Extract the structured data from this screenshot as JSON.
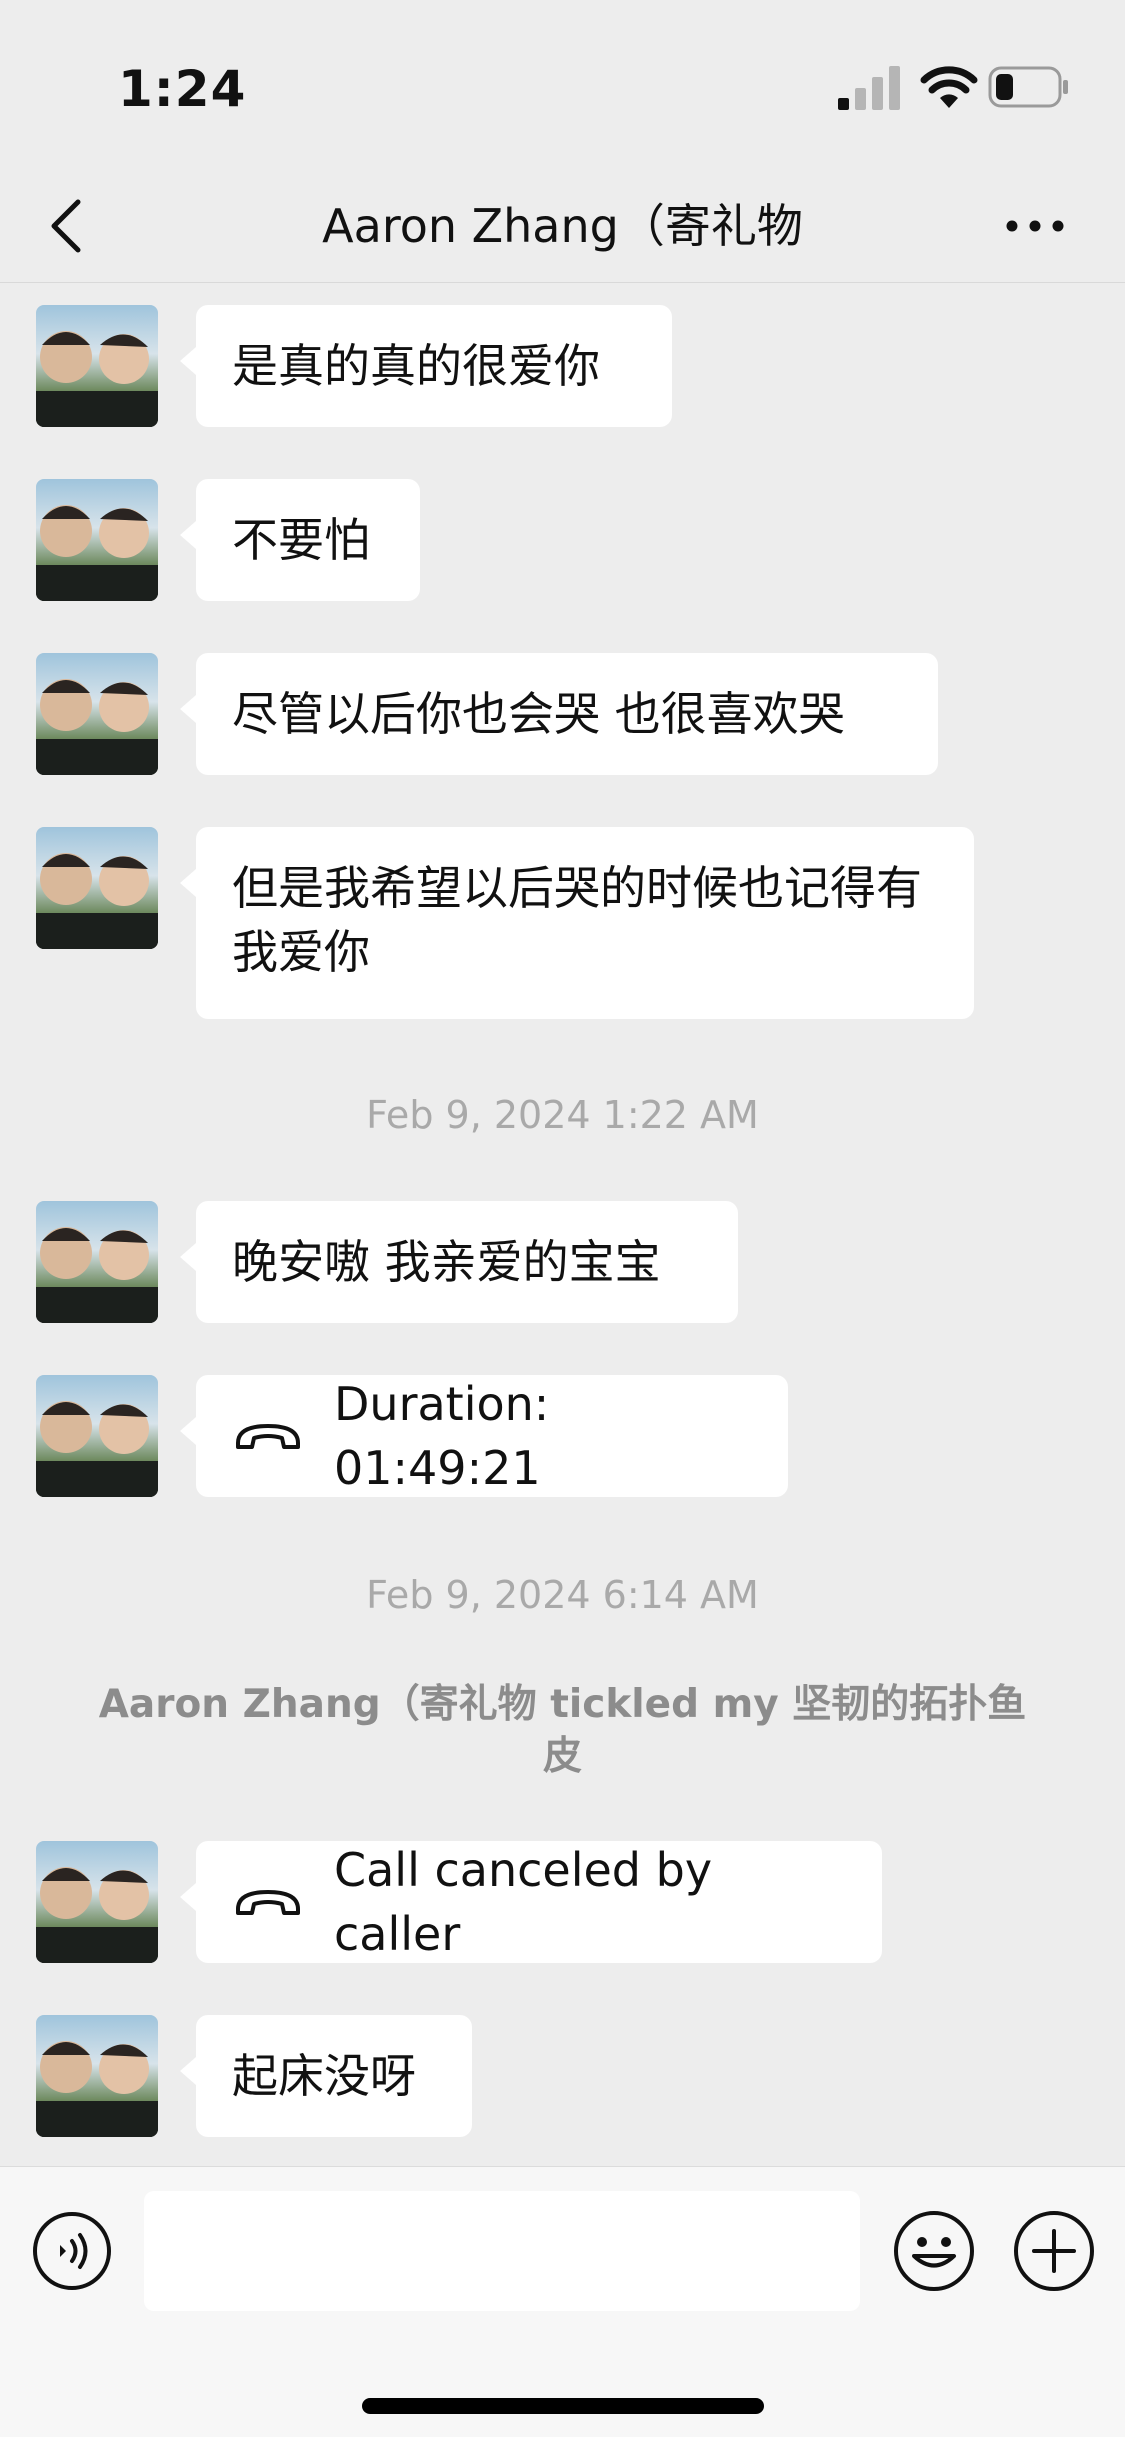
{
  "status_bar": {
    "time": "1:24",
    "battery_level": 0.3
  },
  "header": {
    "title": "Aaron Zhang（寄礼物"
  },
  "messages": [
    {
      "text": "是真的真的很爱你"
    },
    {
      "text": "不要怕"
    },
    {
      "text": "尽管以后你也会哭 也很喜欢哭"
    },
    {
      "text": "但是我希望以后哭的时候也记得有我爱你"
    },
    {
      "timestamp": "Feb 9, 2024 1:22 AM"
    },
    {
      "text": "晚安嗷 我亲爱的宝宝"
    },
    {
      "call_text": "Duration: 01:49:21"
    },
    {
      "timestamp": "Feb 9, 2024 6:14 AM"
    },
    {
      "system": "Aaron Zhang（寄礼物 tickled my  坚韧的拓扑鱼皮"
    },
    {
      "call_text": "Call canceled by caller"
    },
    {
      "text": "起床没呀"
    }
  ],
  "input": {
    "value": ""
  },
  "icons": {
    "back": "chevron-left-icon",
    "more": "more-dots-icon",
    "call": "phone-hangup-icon",
    "voice": "voice-icon",
    "emoji": "emoji-icon",
    "plus": "plus-icon"
  }
}
